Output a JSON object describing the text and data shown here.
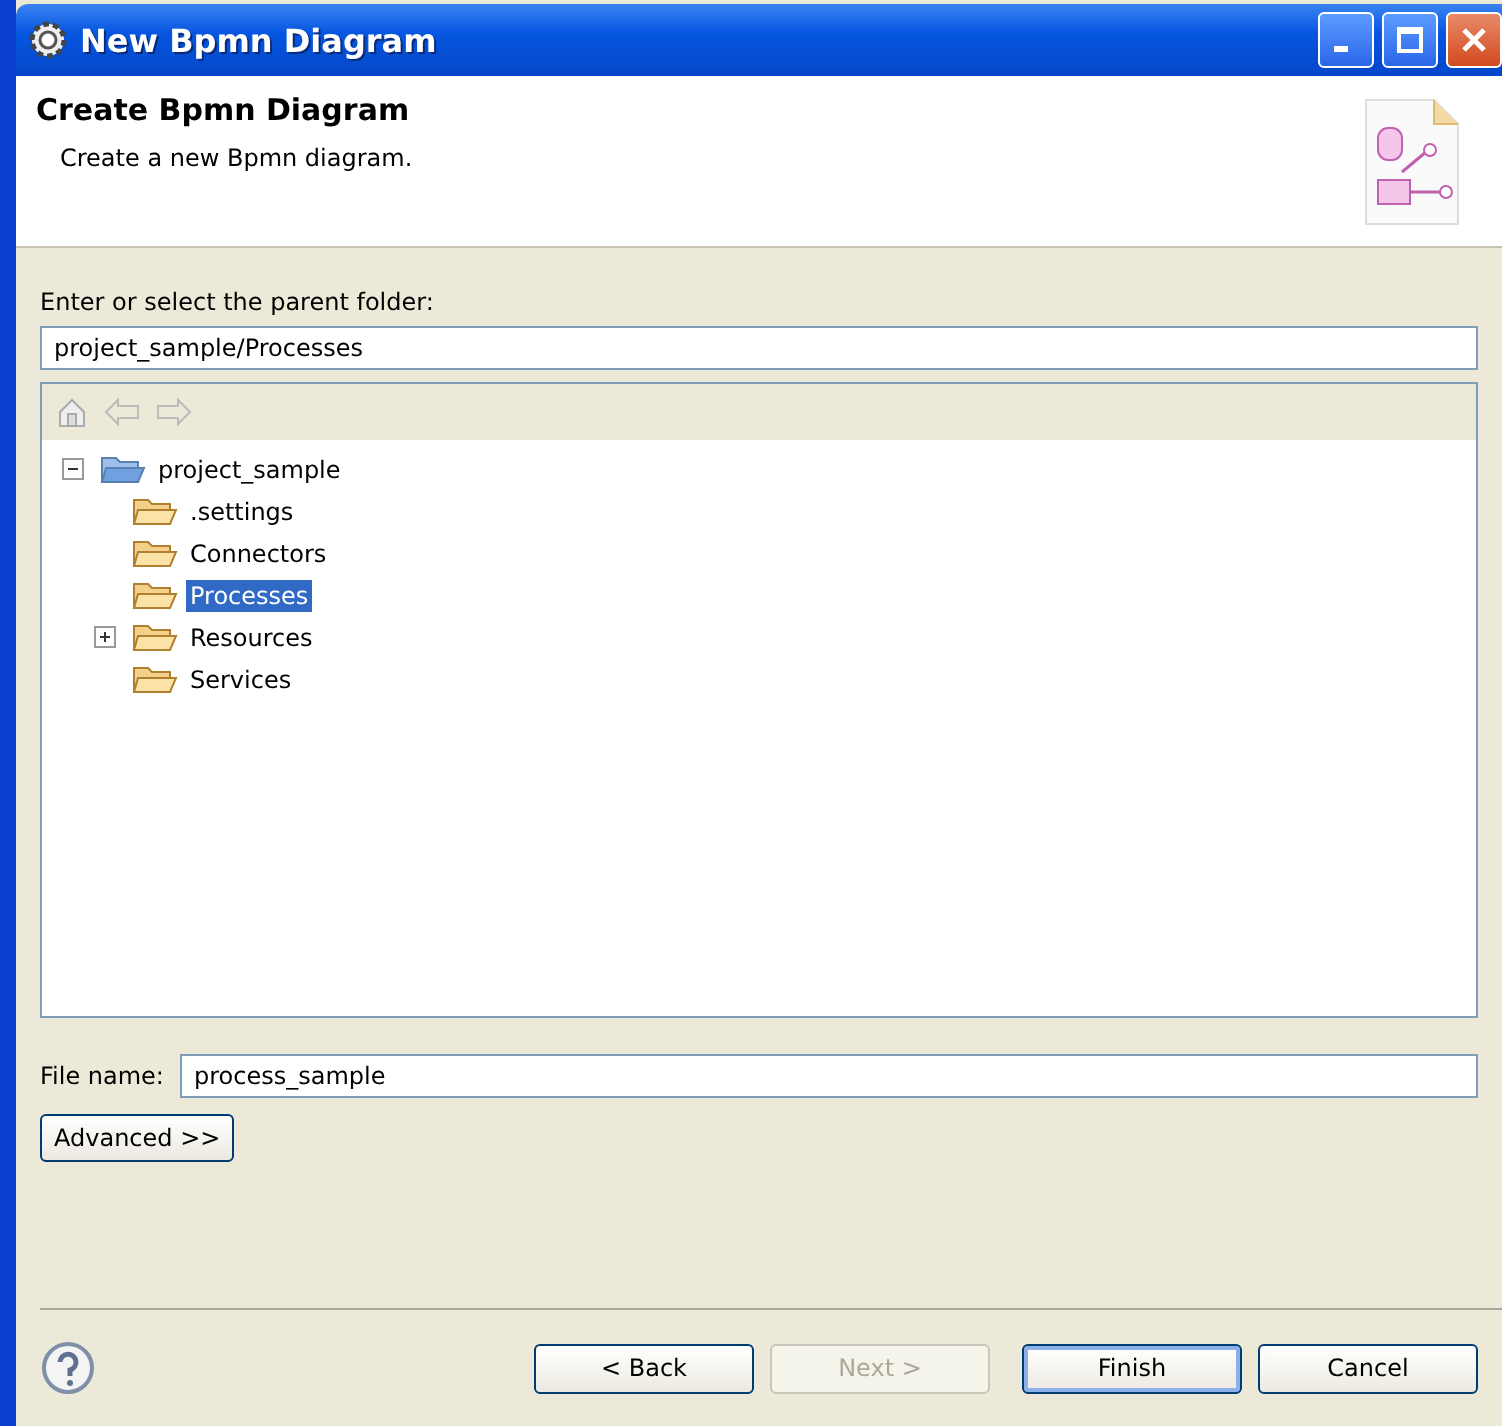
{
  "window": {
    "title": "New Bpmn Diagram"
  },
  "header": {
    "title": "Create Bpmn Diagram",
    "description": "Create a new Bpmn diagram."
  },
  "folder": {
    "label": "Enter or select the parent folder:",
    "value": "project_sample/Processes"
  },
  "tree": [
    {
      "label": "project_sample",
      "expanded": true,
      "selected": false,
      "children": [
        {
          "label": ".settings",
          "selected": false
        },
        {
          "label": "Connectors",
          "selected": false
        },
        {
          "label": "Processes",
          "selected": true
        },
        {
          "label": "Resources",
          "expanded": false,
          "selected": false
        },
        {
          "label": "Services",
          "selected": false
        }
      ]
    }
  ],
  "file_name": {
    "label": "File name:",
    "value": "process_sample"
  },
  "advanced_button": "Advanced >>",
  "buttons": [
    {
      "label": "< Back",
      "disabled": false,
      "default": false
    },
    {
      "label": "Next >",
      "disabled": true,
      "default": false
    },
    {
      "label": "Finish",
      "disabled": false,
      "default": true
    },
    {
      "label": "Cancel",
      "disabled": false,
      "default": false
    }
  ]
}
